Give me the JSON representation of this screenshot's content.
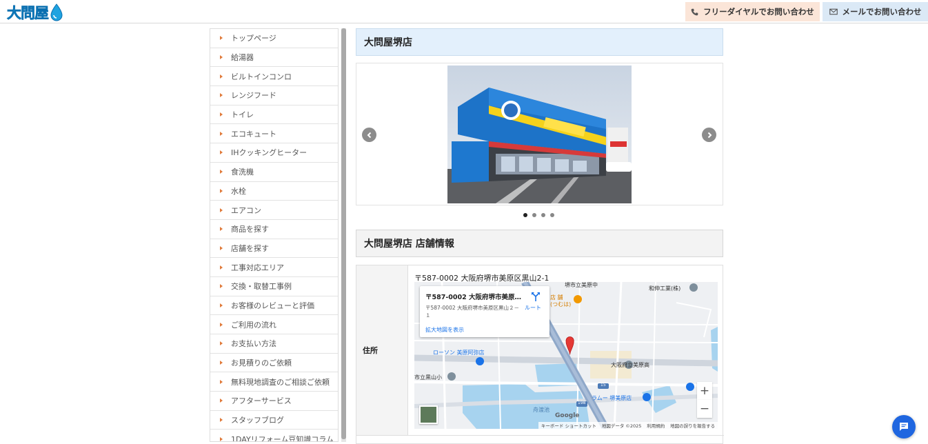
{
  "header": {
    "logo_text": "大問屋",
    "phone_button_label": "フリーダイヤルでお問い合わせ",
    "mail_button_label": "メールでお問い合わせ"
  },
  "sidebar": {
    "items": [
      {
        "label": "トップページ"
      },
      {
        "label": "給湯器"
      },
      {
        "label": "ビルトインコンロ"
      },
      {
        "label": "レンジフード"
      },
      {
        "label": "トイレ"
      },
      {
        "label": "エコキュート"
      },
      {
        "label": "IHクッキングヒーター"
      },
      {
        "label": "食洗機"
      },
      {
        "label": "水栓"
      },
      {
        "label": "エアコン"
      },
      {
        "label": "商品を探す"
      },
      {
        "label": "店舗を探す"
      },
      {
        "label": "工事対応エリア"
      },
      {
        "label": "交換・取替工事例"
      },
      {
        "label": "お客様のレビューと評価"
      },
      {
        "label": "ご利用の流れ"
      },
      {
        "label": "お支払い方法"
      },
      {
        "label": "お見積りのご依頼"
      },
      {
        "label": "無料現地調査のご相談ご依頼"
      },
      {
        "label": "アフターサービス"
      },
      {
        "label": "スタッフブログ"
      },
      {
        "label": "1DAYリフォーム豆知識コラム"
      }
    ]
  },
  "main": {
    "store_heading": "大問屋堺店",
    "carousel": {
      "slide_count": 4,
      "active_index": 0
    },
    "info_heading": "大問屋堺店 店舗情報",
    "info_table": {
      "address_label": "住所",
      "address_value": "〒587-0002 大阪府堺市美原区黒山2-1"
    }
  },
  "map": {
    "card_title": "〒587-0002 大阪府堺市美原区...",
    "card_address": "〒587-0002 大阪府堺市美原区黒山２－１",
    "card_link": "拡大地図を表示",
    "route_label": "ルート",
    "pois": {
      "p1": "堺市立美原中",
      "p2": "和伸工業(株)",
      "p3": "店 舗",
      "p4": "(つむは)",
      "p5": "ローソン 美原阿弥店",
      "p6": "大阪府立美原高",
      "p7": "市立黒山小",
      "p8": "ラムー 堺美原店",
      "p9": "舟渡池",
      "r1": "15",
      "r2": "198"
    },
    "footer": {
      "brand": "Google",
      "shortcuts": "キーボード ショートカット",
      "map_data": "地図データ ©2025",
      "terms": "利用規約",
      "report": "地図の誤りを報告する"
    }
  },
  "colors": {
    "brand_blue": "#1fa3e0",
    "phone_bg": "#fbe5d8",
    "mail_bg": "#dbe9f6",
    "nav_arrow": "#e07a3a",
    "chat_button": "#1f66e0"
  },
  "icons": {
    "phone": "phone-icon",
    "mail": "mail-icon",
    "chat": "chat-icon",
    "prev": "chevron-left-icon",
    "next": "chevron-right-icon"
  }
}
